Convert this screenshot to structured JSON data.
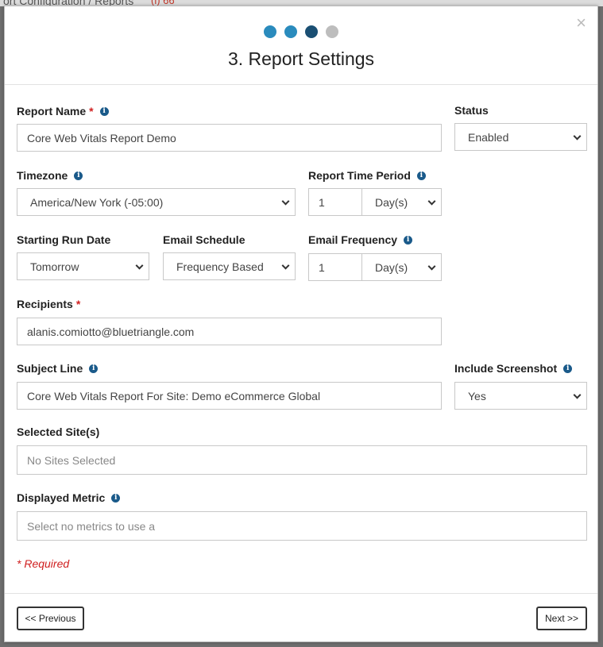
{
  "background": {
    "breadcrumb": "ort Configuration / Reports",
    "badge": "(i) 66"
  },
  "modal": {
    "close_icon": "×",
    "steps": [
      {
        "color": "#2a8bbd"
      },
      {
        "color": "#2a8bbd"
      },
      {
        "color": "#1a4f73"
      },
      {
        "color": "#bdbdbd"
      }
    ],
    "title": "3. Report Settings"
  },
  "form": {
    "report_name": {
      "label": "Report Name",
      "required": "*",
      "value": "Core Web Vitals Report Demo"
    },
    "status": {
      "label": "Status",
      "value": "Enabled"
    },
    "timezone": {
      "label": "Timezone",
      "value": "America/New York (-05:00)"
    },
    "report_time_period": {
      "label": "Report Time Period",
      "number": "1",
      "unit": "Day(s)"
    },
    "starting_run_date": {
      "label": "Starting Run Date",
      "value": "Tomorrow"
    },
    "email_schedule": {
      "label": "Email Schedule",
      "value": "Frequency Based"
    },
    "email_frequency": {
      "label": "Email Frequency",
      "number": "1",
      "unit": "Day(s)"
    },
    "recipients": {
      "label": "Recipients",
      "required": "*",
      "value": "alanis.comiotto@bluetriangle.com"
    },
    "subject_line": {
      "label": "Subject Line",
      "value": "Core Web Vitals Report For Site: Demo eCommerce Global"
    },
    "include_screenshot": {
      "label": "Include Screenshot",
      "value": "Yes"
    },
    "selected_sites": {
      "label": "Selected Site(s)",
      "placeholder": "No Sites Selected"
    },
    "displayed_metric": {
      "label": "Displayed Metric",
      "placeholder": "Select no metrics to use a"
    },
    "required_note": "* Required"
  },
  "footer": {
    "previous_label": "<< Previous",
    "next_label": "Next >>"
  },
  "colors": {
    "accent": "#2a8bbd",
    "accent_dark": "#1a4f73",
    "required": "#d02020",
    "info_icon": "#1a5a8a"
  }
}
